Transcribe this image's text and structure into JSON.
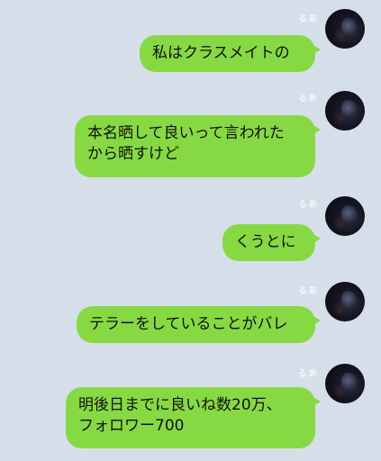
{
  "sender": {
    "name": "るあ"
  },
  "messages": [
    {
      "lines": [
        "私はクラスメイトの"
      ]
    },
    {
      "lines": [
        "本名晒して良いって言われた",
        "から晒すけど"
      ]
    },
    {
      "lines": [
        "くうとに"
      ]
    },
    {
      "lines": [
        "テラーをしていることがバレ"
      ]
    },
    {
      "lines": [
        "明後日までに良いね数20万、",
        "フォロワー700"
      ]
    }
  ],
  "colors": {
    "background": "#d6dfe9",
    "bubble": "#87d944",
    "name_text": "#ffffff",
    "message_text": "#111111"
  }
}
